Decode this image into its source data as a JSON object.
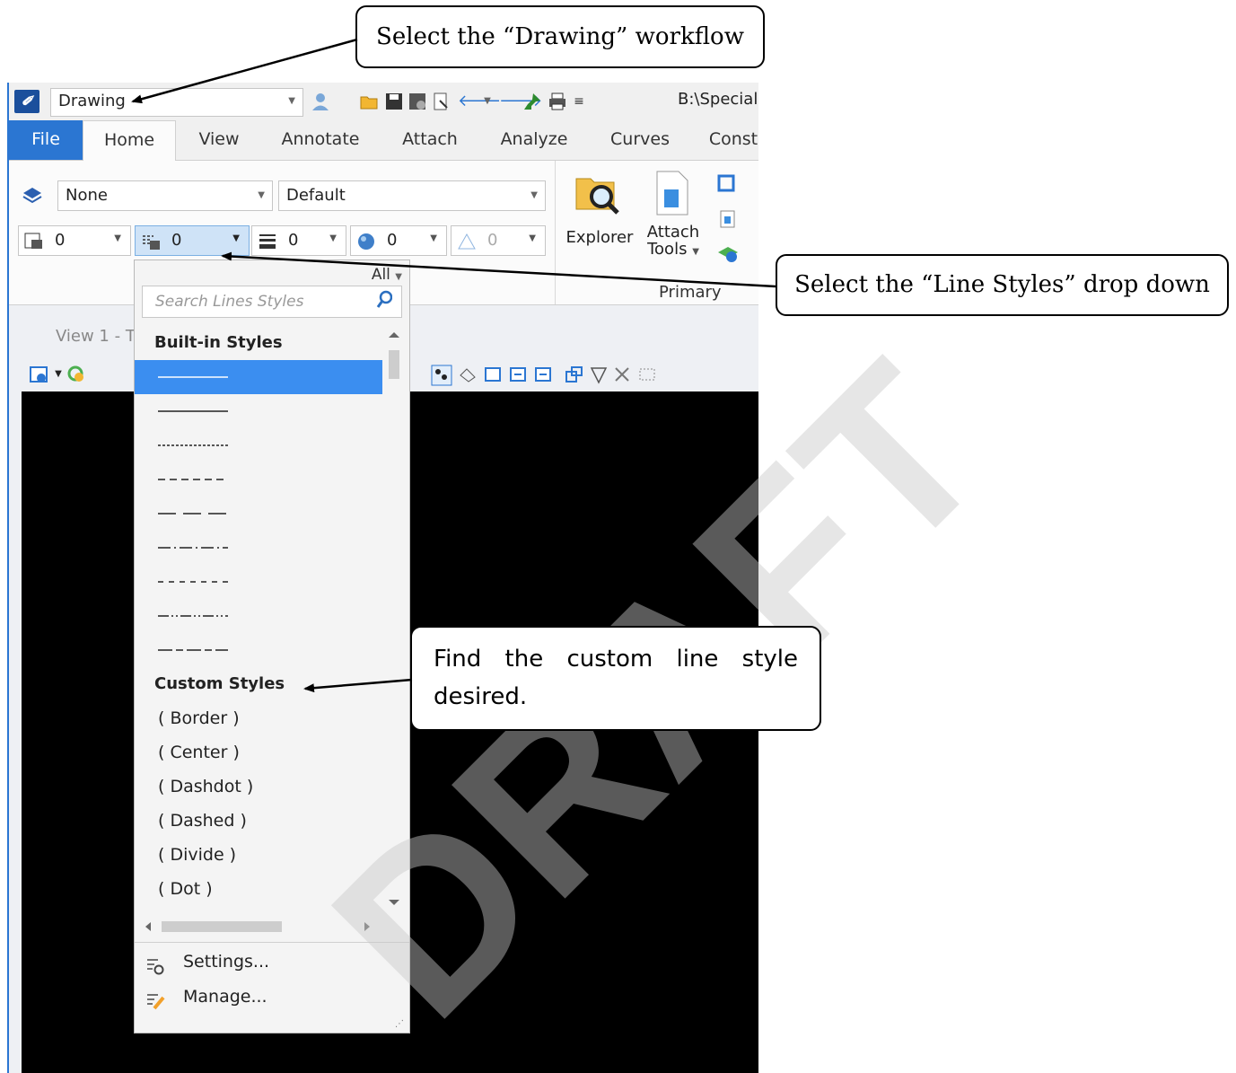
{
  "callouts": {
    "top": "Select the “Drawing” workflow",
    "right": "Select the “Line Styles” drop down",
    "middle": "Find the custom line style desired."
  },
  "watermark": "DRAFT",
  "qat": {
    "logo": "✐",
    "workflow_value": "Drawing",
    "path": "B:\\Special"
  },
  "tabs": [
    "File",
    "Home",
    "View",
    "Annotate",
    "Attach",
    "Analyze",
    "Curves",
    "Const"
  ],
  "ribbon": {
    "level_value": "None",
    "style_value": "Default",
    "small_fields": [
      "0",
      "0",
      "0",
      "0",
      "0"
    ],
    "explorer_label": "Explorer",
    "attach_label": "Attach",
    "attach_tools_label": "Tools",
    "group_label": "Primary"
  },
  "view": {
    "title": "View 1 - T"
  },
  "dropdown": {
    "filter_label": "All",
    "search_placeholder": "Search Lines Styles",
    "builtin_header": "Built-in Styles",
    "builtin_styles": [
      "solid",
      "solid",
      "dotted",
      "dashed",
      "long-dash",
      "dash-dot",
      "short-dash",
      "dash-dot-dot",
      "long-short"
    ],
    "custom_header": "Custom Styles",
    "custom_styles": [
      "( Border )",
      "( Center )",
      "( Dashdot )",
      "( Dashed )",
      "( Divide )",
      "( Dot )"
    ],
    "settings_label": "Settings...",
    "manage_label": "Manage..."
  },
  "colors": {
    "accent": "#2b76d2",
    "selection": "#3b8ef0",
    "canvas": "#000000"
  }
}
